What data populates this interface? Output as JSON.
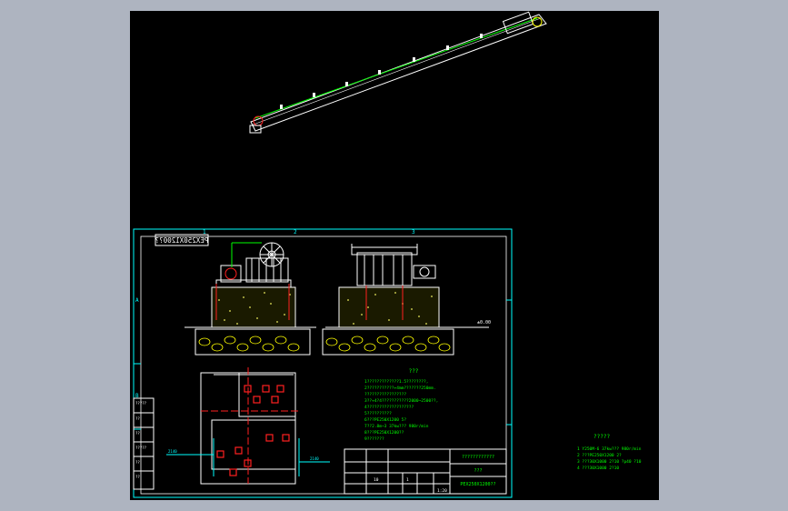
{
  "colors": {
    "background": "#aeb4c0",
    "canvas": "#000000",
    "frame": "#00ffff",
    "outline": "#ffffff",
    "accent": "#ff2020",
    "notes": "#00ff00",
    "hatch": "#ffff00",
    "concrete": "#ffff66"
  },
  "drawing": {
    "stamp_code": "PEX250X1200??",
    "section_tag": "1",
    "ground_label": "±0.00",
    "grid_top_labels": [
      "1",
      "2",
      "3",
      "4"
    ],
    "grid_side_labels": [
      "A",
      "B",
      "C"
    ],
    "dim_left_label": "2140",
    "dim_right_label": "2140"
  },
  "notes": {
    "heading": "???",
    "lines": [
      "1?????????????1.5????????,",
      "2???????????+4mm???????250mm.",
      "  ?????????????????",
      "3??+4?4???????????2000~2500??,",
      "4???????????????????",
      "5??????????",
      "6???PE250X1200  5?",
      "7??2.8m~3   37kw???  980r/min",
      "8???PE250X1200??",
      "9???????"
    ]
  },
  "title_block": {
    "title": "????????????",
    "subtitle": "???",
    "drawing_number": "PEX250X1200??",
    "cells": [
      "10",
      "1",
      "1:20"
    ],
    "left_labels": [
      "?????",
      "??",
      "??",
      "?????",
      "??",
      "??"
    ]
  },
  "legend": {
    "heading": "?????",
    "items": [
      "1   Y250M-6    37kw???   980r/min",
      "2   ???PE250X1200   2?",
      "3   ???30X1000   2?10    ?p40  ?10",
      "4   ???30X1000   2?10"
    ]
  }
}
